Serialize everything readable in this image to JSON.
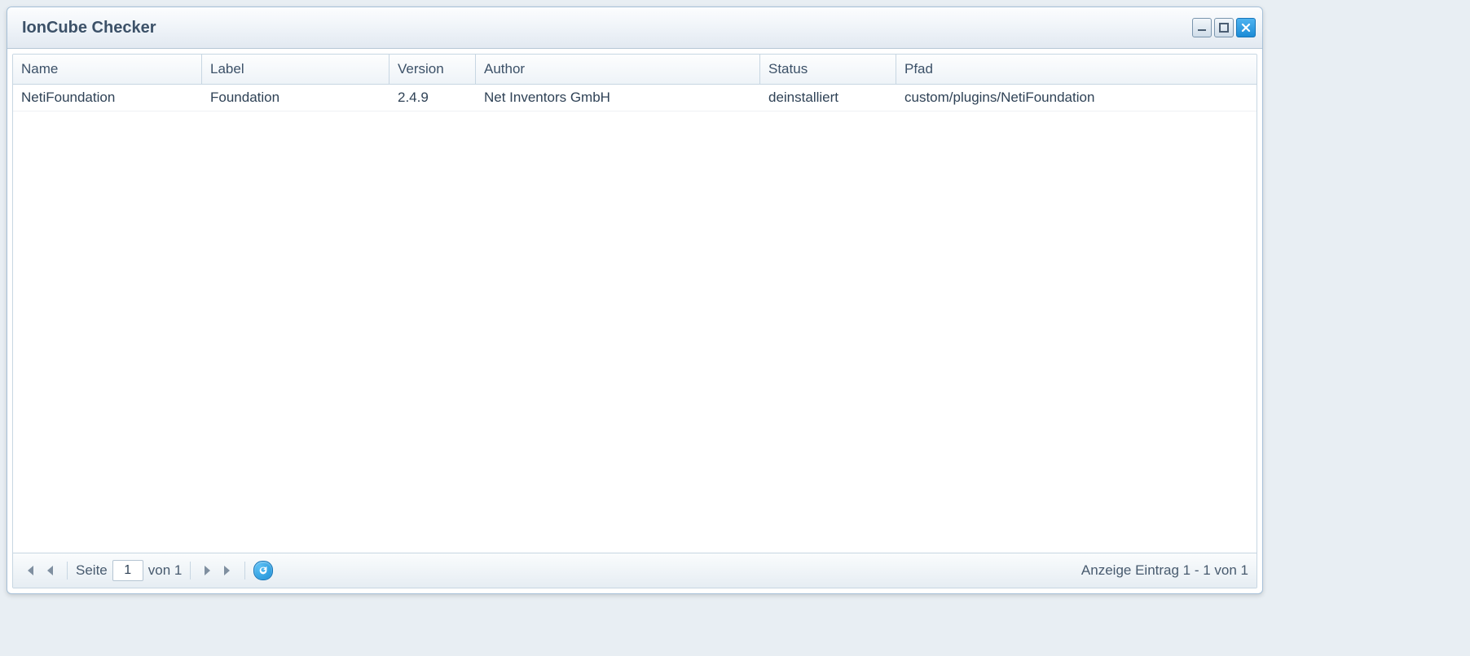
{
  "window": {
    "title": "IonCube Checker"
  },
  "columns": {
    "name": "Name",
    "label": "Label",
    "version": "Version",
    "author": "Author",
    "status": "Status",
    "path": "Pfad"
  },
  "rows": [
    {
      "name": "NetiFoundation",
      "label": "Foundation",
      "version": "2.4.9",
      "author": "Net Inventors GmbH",
      "status": "deinstalliert",
      "path": "custom/plugins/NetiFoundation"
    }
  ],
  "pager": {
    "page_label": "Seite",
    "current_page": "1",
    "of_label": "von 1",
    "display_text": "Anzeige Eintrag 1 - 1 von 1"
  }
}
